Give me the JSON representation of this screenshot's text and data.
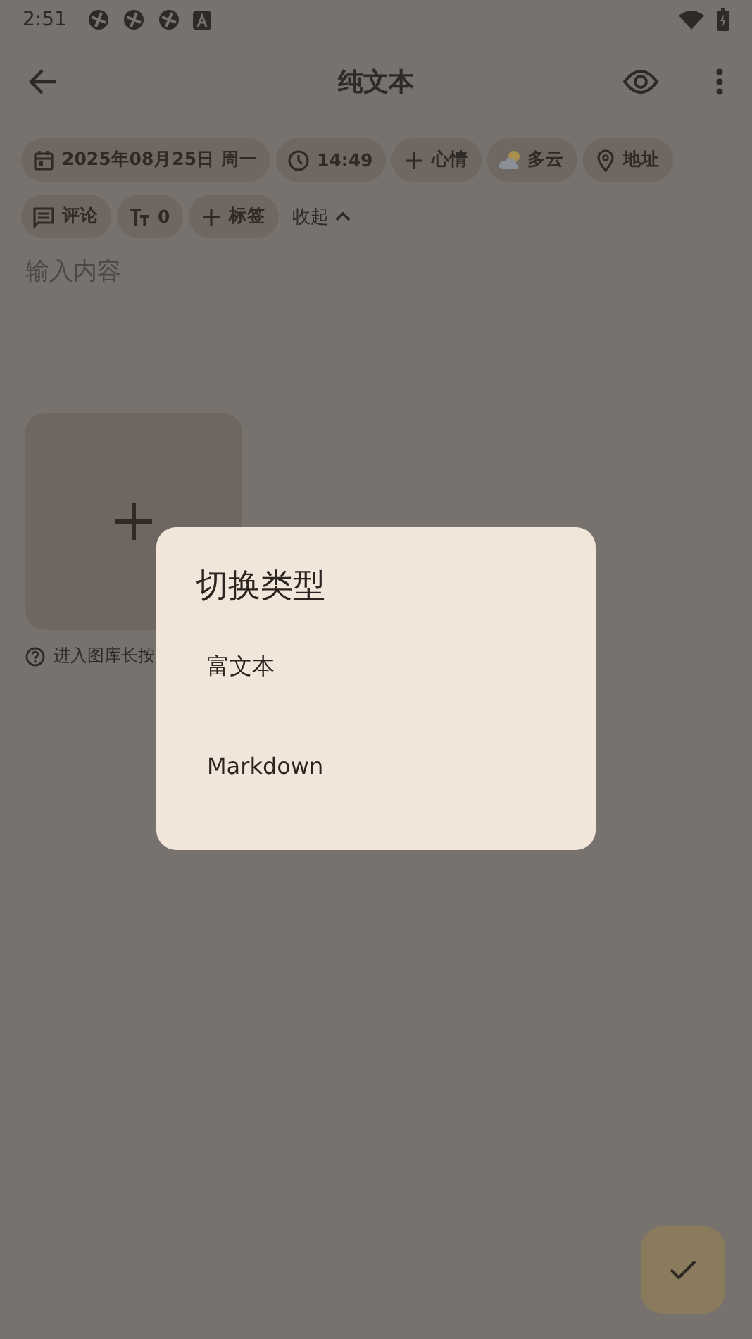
{
  "status_bar": {
    "time": "2:51"
  },
  "app_bar": {
    "title": "纯文本"
  },
  "chips": [
    {
      "kind": "date",
      "label": "2025年08月25日 周一"
    },
    {
      "kind": "time",
      "label": "14:49"
    },
    {
      "kind": "add",
      "label": "心情"
    },
    {
      "kind": "weather",
      "label": "多云"
    },
    {
      "kind": "location",
      "label": "地址"
    },
    {
      "kind": "comment",
      "label": "评论"
    },
    {
      "kind": "text_size",
      "label": "0"
    },
    {
      "kind": "add",
      "label": "标签"
    }
  ],
  "collapse": {
    "label": "收起"
  },
  "editor": {
    "placeholder": "输入内容"
  },
  "image_hint": "进入图库长按",
  "dialog": {
    "title": "切换类型",
    "options": [
      "富文本",
      "Markdown"
    ]
  }
}
